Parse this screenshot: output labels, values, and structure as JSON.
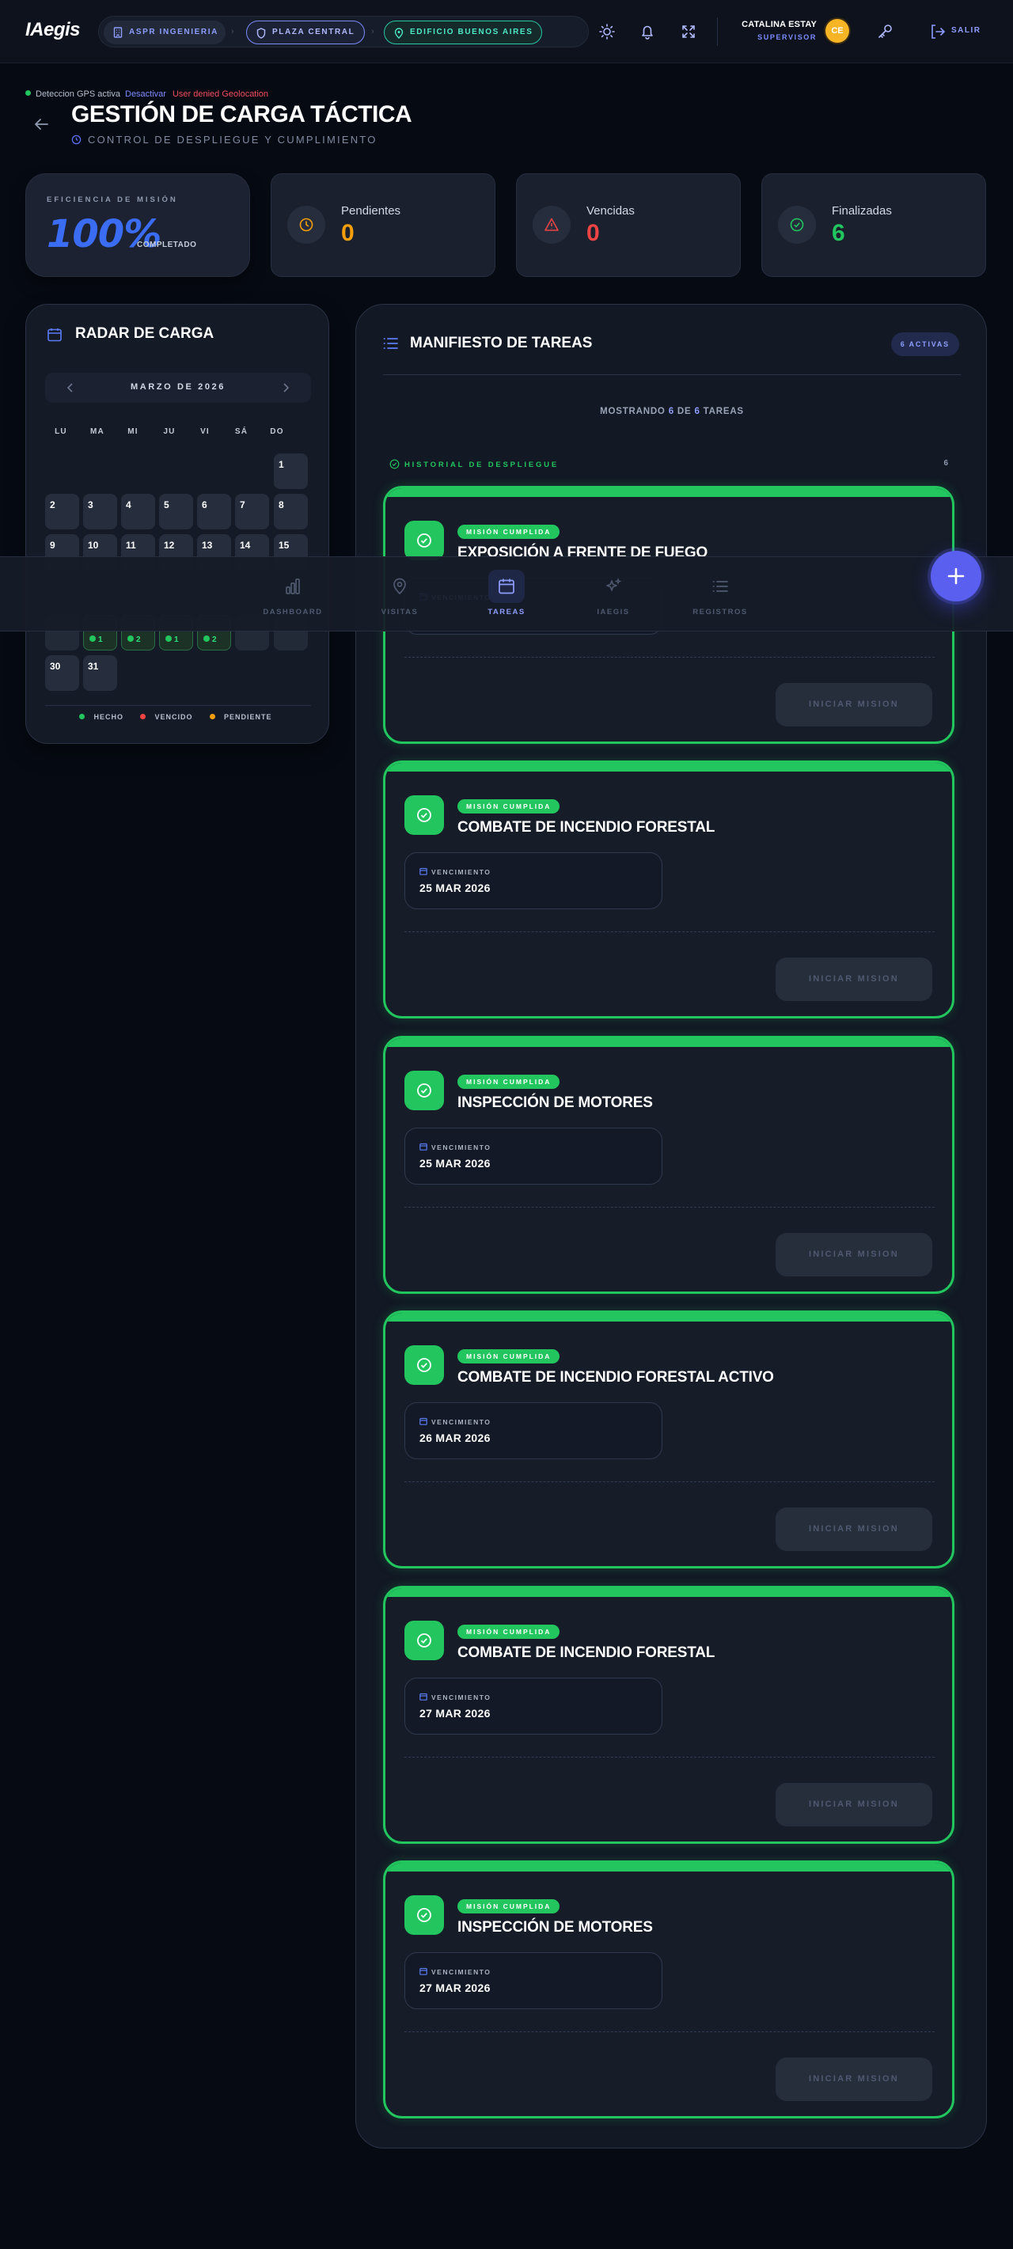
{
  "app": {
    "logo": "IAegis"
  },
  "breadcrumbs": [
    "ASPR INGENIERIA",
    "PLAZA CENTRAL",
    "EDIFICIO BUENOS AIRES"
  ],
  "user": {
    "name": "CATALINA ESTAY",
    "role": "SUPERVISOR",
    "initials": "CE"
  },
  "logout_label": "SALIR",
  "gps": {
    "status": "Deteccion GPS activa",
    "action": "Desactivar",
    "error": "User denied Geolocation"
  },
  "header": {
    "title": "GESTIÓN DE CARGA TÁCTICA",
    "subtitle": "CONTROL DE DESPLIEGUE Y CUMPLIMIENTO"
  },
  "stats": {
    "efficiency": {
      "label": "EFICIENCIA DE MISIÓN",
      "value": "100%",
      "sub": "COMPLETADO"
    },
    "pending": {
      "label": "Pendientes",
      "value": "0",
      "color": "#f59e0b"
    },
    "overdue": {
      "label": "Vencidas",
      "value": "0",
      "color": "#ef4444"
    },
    "done": {
      "label": "Finalizadas",
      "value": "6",
      "color": "#22c55e"
    }
  },
  "calendar": {
    "title": "RADAR DE CARGA",
    "month": "MARZO DE 2026",
    "weekdays": [
      "LU",
      "MA",
      "MI",
      "JU",
      "VI",
      "SÁ",
      "DO"
    ],
    "days_visible": [
      "1",
      "2",
      "3",
      "4",
      "5",
      "6",
      "7",
      "8",
      "9",
      "10",
      "11",
      "12",
      "13",
      "14",
      "15",
      "30",
      "31"
    ],
    "completed_badges": [
      "1",
      "2",
      "1",
      "2"
    ],
    "legend": [
      "HECHO",
      "VENCIDO",
      "PENDIENTE"
    ],
    "legend_colors": [
      "#22c55e",
      "#ef4444",
      "#f59e0b"
    ]
  },
  "manifest": {
    "title": "MANIFIESTO DE TAREAS",
    "active_badge": "6 ACTIVAS",
    "showing_prefix": "MOSTRANDO",
    "showing_count": "6",
    "showing_mid": "DE",
    "showing_total": "6",
    "showing_suffix": "TAREAS",
    "history_label": "HISTORIAL DE DESPLIEGUE",
    "history_count": "6",
    "due_label": "VENCIMIENTO",
    "start_label": "INICIAR MISION",
    "status_label": "MISIÓN CUMPLIDA",
    "tasks": [
      {
        "name": "EXPOSICIÓN A FRENTE DE FUEGO",
        "due": ""
      },
      {
        "name": "COMBATE DE INCENDIO FORESTAL",
        "due": "25 MAR 2026"
      },
      {
        "name": "INSPECCIÓN DE MOTORES",
        "due": "25 MAR 2026"
      },
      {
        "name": "COMBATE DE INCENDIO FORESTAL ACTIVO",
        "due": "26 MAR 2026"
      },
      {
        "name": "COMBATE DE INCENDIO FORESTAL",
        "due": "27 MAR 2026"
      },
      {
        "name": "INSPECCIÓN DE MOTORES",
        "due": "27 MAR 2026"
      }
    ]
  },
  "nav": [
    "DASHBOARD",
    "VISITAS",
    "TAREAS",
    "IAEGIS",
    "REGISTROS"
  ],
  "nav_active": "TAREAS",
  "icons": {
    "theme": "sun-icon",
    "notifications": "bell-icon",
    "fullscreen": "expand-icon",
    "key": "key-icon",
    "logout": "logout-icon",
    "fab": "plus-icon"
  }
}
